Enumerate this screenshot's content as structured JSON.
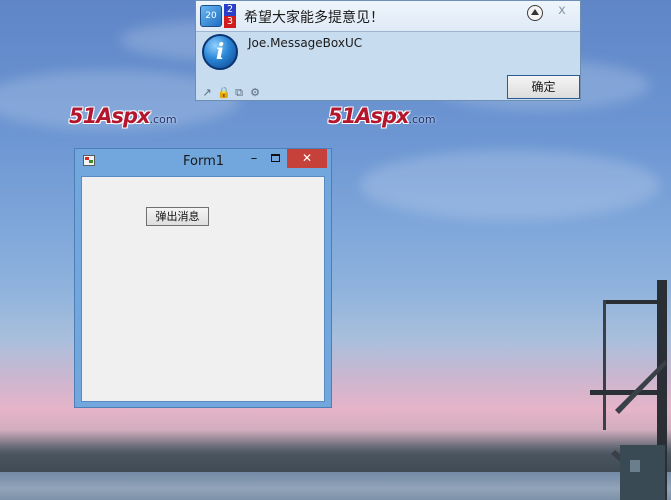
{
  "watermarks": [
    {
      "main": "51Aspx",
      "suffix": ".com"
    },
    {
      "main": "51Aspx",
      "suffix": ".com"
    }
  ],
  "notification": {
    "app_icon_text": "20",
    "number_top": "2",
    "number_bottom": "3",
    "title": "希望大家能多提意见！",
    "close_glyph": "x",
    "info_glyph": "i",
    "message": "Joe.MessageBoxUC",
    "ok_label": "确定",
    "footer_icons": [
      "link-icon",
      "lock-icon",
      "copy-icon",
      "gear-icon"
    ]
  },
  "form1": {
    "title": "Form1",
    "minimize_glyph": "–",
    "close_glyph": "✕",
    "popup_button_label": "弹出消息"
  },
  "colors": {
    "close_red": "#c7413b",
    "window_frame": "#71a7dd",
    "logo_red": "#b3162d",
    "logo_blue": "#1e2f6b"
  }
}
